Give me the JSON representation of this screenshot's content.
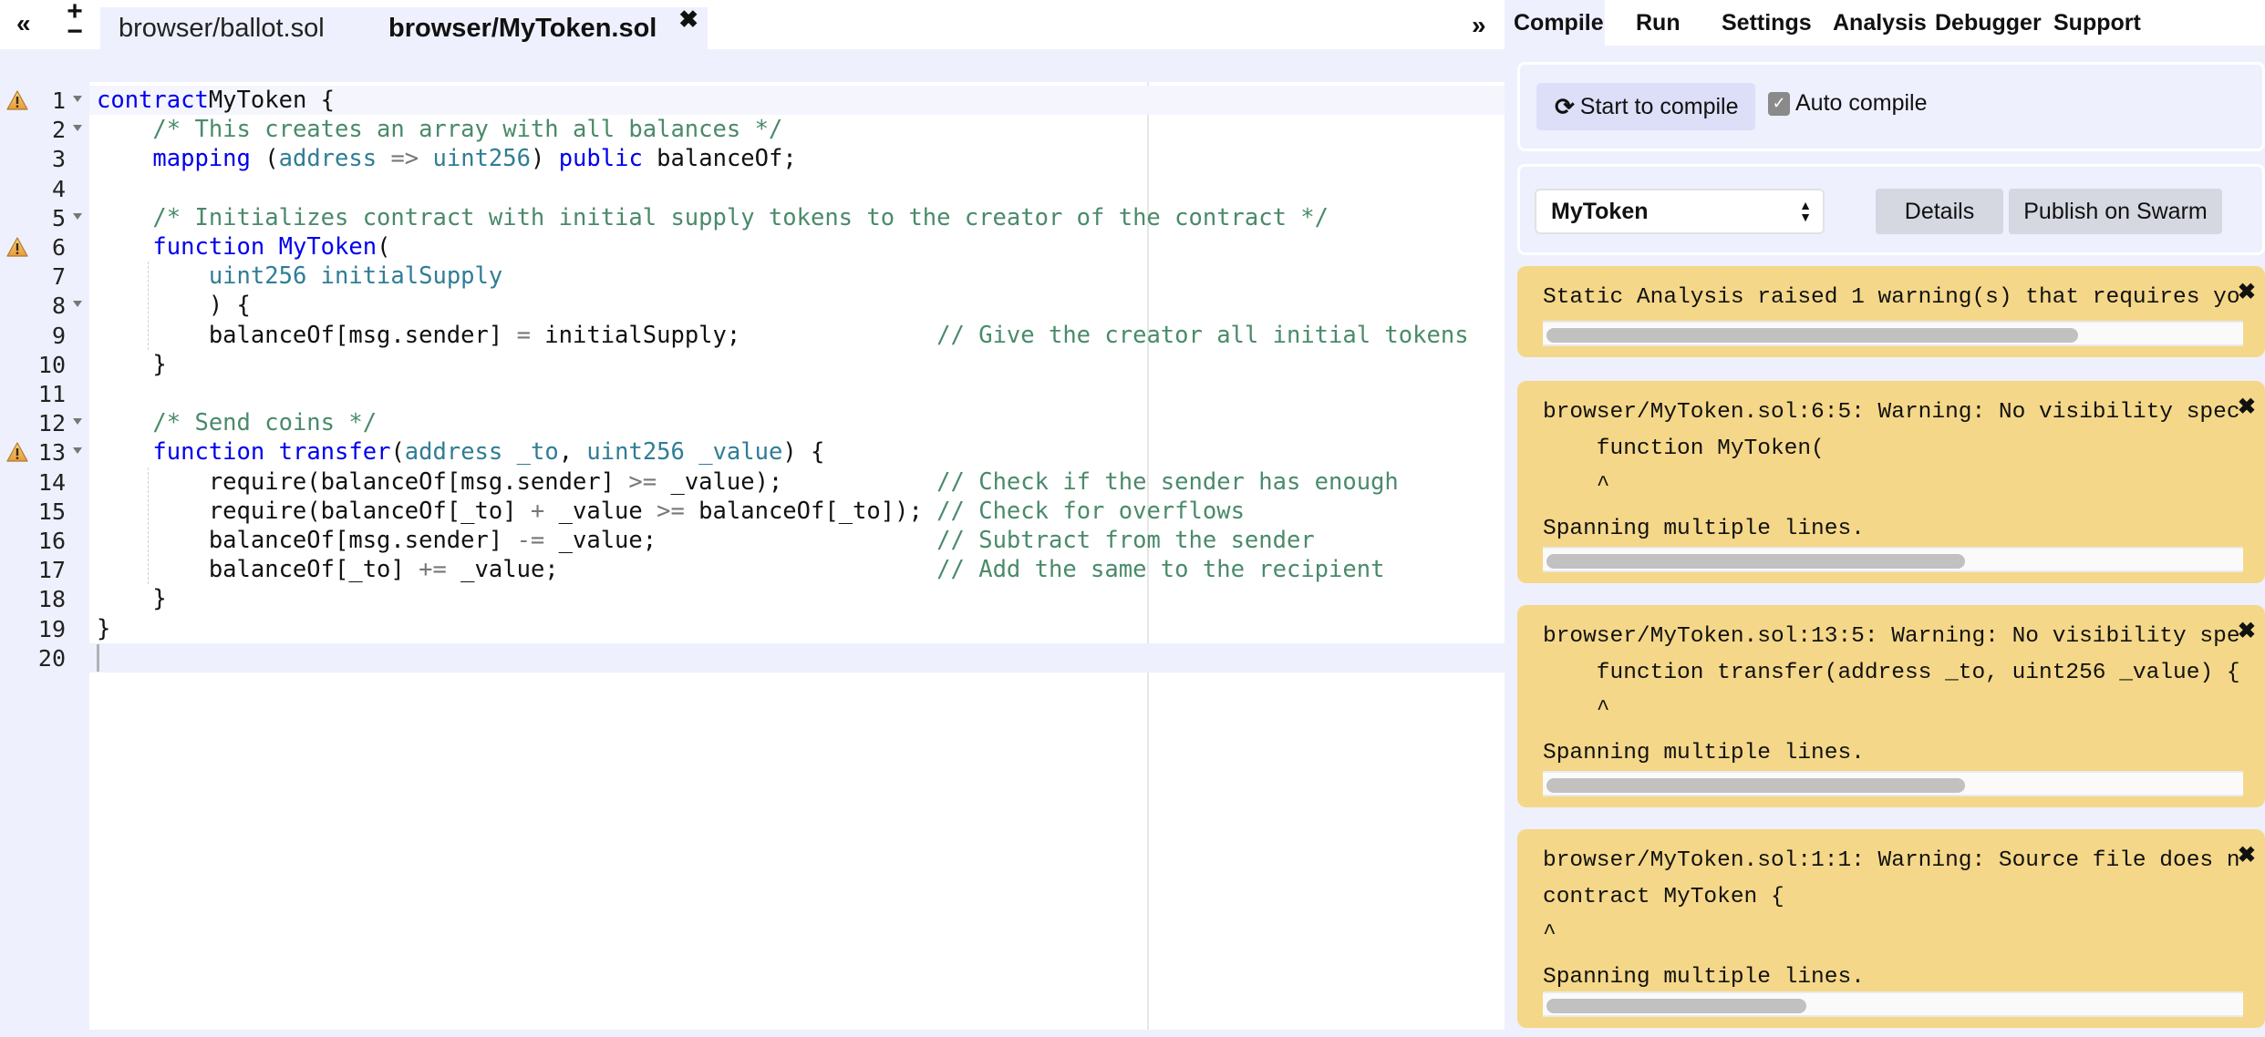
{
  "editor": {
    "tabbar": {
      "collapse_icon": "«",
      "add_icon": "+",
      "remove_icon": "−",
      "expand_icon": "»",
      "tabs": [
        {
          "label": "browser/ballot.sol",
          "active": false
        },
        {
          "label": "browser/MyToken.sol",
          "active": true,
          "close_icon": "✖"
        }
      ]
    },
    "active_line": 20,
    "warning_lines": [
      1,
      6,
      13
    ],
    "fold_lines": [
      1,
      2,
      5,
      8,
      12,
      13
    ],
    "lines": [
      {
        "n": "1",
        "tokens": [
          [
            "kw",
            "contract"
          ],
          [
            "",
            "MyToken {"
          ]
        ]
      },
      {
        "n": "2",
        "tokens": [
          [
            "",
            "    "
          ],
          [
            "cm",
            "/* This creates an array with all balances */"
          ]
        ]
      },
      {
        "n": "3",
        "tokens": [
          [
            "",
            "    "
          ],
          [
            "kw",
            "mapping"
          ],
          [
            "",
            " ("
          ],
          [
            "ty",
            "address"
          ],
          [
            "",
            " "
          ],
          [
            "op",
            "=>"
          ],
          [
            "",
            " "
          ],
          [
            "ty",
            "uint256"
          ],
          [
            "",
            ") "
          ],
          [
            "kw",
            "public"
          ],
          [
            "",
            " balanceOf;"
          ]
        ]
      },
      {
        "n": "4",
        "tokens": []
      },
      {
        "n": "5",
        "tokens": [
          [
            "",
            "    "
          ],
          [
            "cm",
            "/* Initializes contract with initial supply tokens to the creator of the contract */"
          ]
        ]
      },
      {
        "n": "6",
        "tokens": [
          [
            "",
            "    "
          ],
          [
            "kw",
            "function"
          ],
          [
            "",
            " "
          ],
          [
            "kw",
            "MyToken"
          ],
          [
            "",
            "("
          ]
        ]
      },
      {
        "n": "7",
        "tokens": [
          [
            "",
            "        "
          ],
          [
            "ty",
            "uint256 initialSupply"
          ]
        ]
      },
      {
        "n": "8",
        "tokens": [
          [
            "",
            "        ) {"
          ]
        ]
      },
      {
        "n": "9",
        "tokens": [
          [
            "",
            "        balanceOf[msg.sender] "
          ],
          [
            "op",
            "="
          ],
          [
            "",
            " initialSupply;              "
          ],
          [
            "cm",
            "// Give the creator all initial tokens"
          ]
        ]
      },
      {
        "n": "10",
        "tokens": [
          [
            "",
            "    }"
          ]
        ]
      },
      {
        "n": "11",
        "tokens": []
      },
      {
        "n": "12",
        "tokens": [
          [
            "",
            "    "
          ],
          [
            "cm",
            "/* Send coins */"
          ]
        ]
      },
      {
        "n": "13",
        "tokens": [
          [
            "",
            "    "
          ],
          [
            "kw",
            "function"
          ],
          [
            "",
            " "
          ],
          [
            "kw",
            "transfer"
          ],
          [
            "",
            "("
          ],
          [
            "ty",
            "address _to"
          ],
          [
            "",
            ", "
          ],
          [
            "ty",
            "uint256 _value"
          ],
          [
            "",
            ") {"
          ]
        ]
      },
      {
        "n": "14",
        "tokens": [
          [
            "",
            "        require(balanceOf[msg.sender] "
          ],
          [
            "op",
            ">="
          ],
          [
            "",
            " _value);           "
          ],
          [
            "cm",
            "// Check if the sender has enough"
          ]
        ]
      },
      {
        "n": "15",
        "tokens": [
          [
            "",
            "        require(balanceOf[_to] "
          ],
          [
            "op",
            "+"
          ],
          [
            "",
            " _value "
          ],
          [
            "op",
            ">="
          ],
          [
            "",
            " balanceOf[_to]); "
          ],
          [
            "cm",
            "// Check for overflows"
          ]
        ]
      },
      {
        "n": "16",
        "tokens": [
          [
            "",
            "        balanceOf[msg.sender] "
          ],
          [
            "op",
            "-="
          ],
          [
            "",
            " _value;                    "
          ],
          [
            "cm",
            "// Subtract from the sender"
          ]
        ]
      },
      {
        "n": "17",
        "tokens": [
          [
            "",
            "        balanceOf[_to] "
          ],
          [
            "op",
            "+="
          ],
          [
            "",
            " _value;                           "
          ],
          [
            "cm",
            "// Add the same to the recipient"
          ]
        ]
      },
      {
        "n": "18",
        "tokens": [
          [
            "",
            "    }"
          ]
        ]
      },
      {
        "n": "19",
        "tokens": [
          [
            "",
            "}"
          ]
        ]
      },
      {
        "n": "20",
        "tokens": []
      }
    ]
  },
  "right_panel": {
    "tabs": [
      "Compile",
      "Run",
      "Settings",
      "Analysis",
      "Debugger",
      "Support"
    ],
    "active_tab": "Compile",
    "compile": {
      "button_label": "Start to compile",
      "button_icon": "refresh-icon",
      "auto_compile_label": "Auto compile",
      "auto_compile_checked": true
    },
    "contract": {
      "selected": "MyToken",
      "details_label": "Details",
      "publish_label": "Publish on Swarm"
    },
    "warnings": [
      {
        "lines": [
          "Static Analysis raised 1 warning(s) that requires yo"
        ],
        "scroll_fraction": 0.47
      },
      {
        "lines": [
          "browser/MyToken.sol:6:5: Warning: No visibility spec",
          "    function MyToken(",
          "    ^",
          "Spanning multiple lines."
        ],
        "scroll_fraction": 0.37
      },
      {
        "lines": [
          "browser/MyToken.sol:13:5: Warning: No visibility spe",
          "    function transfer(address _to, uint256 _value) {",
          "    ^",
          "Spanning multiple lines."
        ],
        "scroll_fraction": 0.37
      },
      {
        "lines": [
          "browser/MyToken.sol:1:1: Warning: Source file does n",
          "contract MyToken {",
          "^",
          "Spanning multiple lines."
        ],
        "scroll_fraction": 0.23
      }
    ],
    "close_icon": "✖"
  },
  "colors": {
    "keyword": "#0000ee",
    "type": "#2f7d95",
    "comment": "#4a8a6a",
    "warning_bg": "#f4d788",
    "panel_bg": "#eef0fd"
  }
}
